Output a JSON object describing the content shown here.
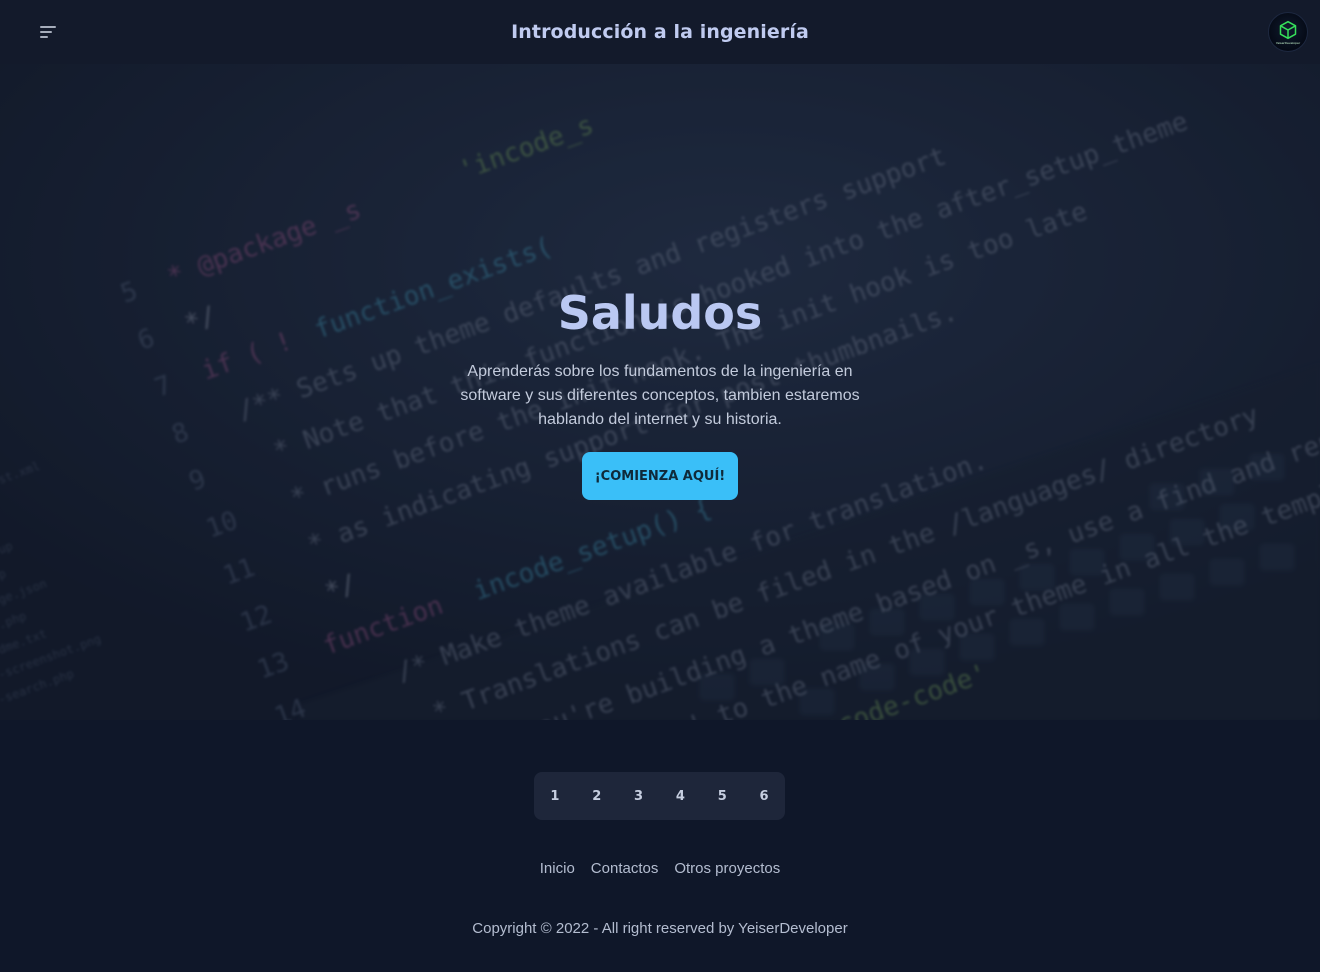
{
  "navbar": {
    "title": "Introducción a la ingeniería",
    "avatar_label": "YeiserDeveloper"
  },
  "hero": {
    "title": "Saludos",
    "description": "Aprenderás sobre los fundamentos de la ingeniería en software y sus diferentes conceptos, tambien estaremos hablando del internet y su historia.",
    "cta_label": "¡COMIENZA AQUÍ!"
  },
  "pagination": {
    "pages": [
      "1",
      "2",
      "3",
      "4",
      "5",
      "6"
    ]
  },
  "footer": {
    "links": [
      "Inicio",
      "Contactos",
      "Otros proyectos"
    ],
    "copyright": "Copyright © 2022 - All right reserved by YeiserDeveloper"
  },
  "colors": {
    "background": "#0f1729",
    "navbar": "#131a2b",
    "accent": "#3abff8",
    "title": "#bac8f2"
  },
  "icons": {
    "menu": "hamburger-menu-icon",
    "avatar_logo": "cube-icon"
  }
}
